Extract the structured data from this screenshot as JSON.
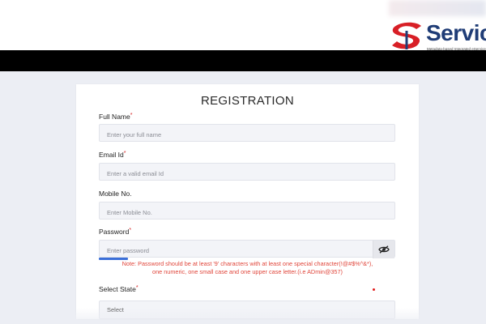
{
  "header": {
    "brand_name": "Service",
    "brand_tagline": "Metadata-based Integrated eService"
  },
  "form": {
    "title": "REGISTRATION",
    "required_marker": "*",
    "fields": {
      "full_name": {
        "label": "Full Name",
        "placeholder": "Enter your full name"
      },
      "email": {
        "label": "Email Id",
        "placeholder": "Enter a valid email Id"
      },
      "mobile": {
        "label": "Mobile No.",
        "placeholder": "Enter Mobile No."
      },
      "password": {
        "label": "Password",
        "placeholder": "Enter password"
      },
      "state": {
        "label": "Select State",
        "value": "Select"
      }
    },
    "password_note_line1": "Note: Password should be at least '9' characters with at least one special character(!@#$%^&*),",
    "password_note_line2": "one numeric, one small case and one upper case letter.(i.e ADmin@357)"
  },
  "colors": {
    "accent_blue": "#1f3c76",
    "required_red": "#d62020",
    "note_red": "#e0453a",
    "header_black": "#000000"
  },
  "icons": {
    "password_toggle": "eye-slash-icon"
  }
}
